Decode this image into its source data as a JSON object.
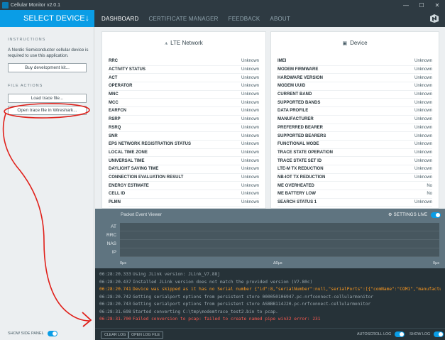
{
  "window": {
    "title": "Cellular Monitor v2.0.1",
    "controls": [
      "—",
      "☐",
      "✕"
    ]
  },
  "header": {
    "select_device": "SELECT DEVICE",
    "tabs": [
      {
        "label": "DASHBOARD",
        "active": true
      },
      {
        "label": "CERTIFICATE MANAGER",
        "active": false
      },
      {
        "label": "FEEDBACK",
        "active": false
      },
      {
        "label": "ABOUT",
        "active": false
      }
    ]
  },
  "sidebar": {
    "instructions_title": "INSTRUCTIONS",
    "instructions_text": "A Nordic Semiconductor cellular device is required to use this application.",
    "buy_button": "Buy development kit...",
    "file_actions_title": "FILE ACTIONS",
    "load_button": "Load trace file...",
    "wireshark_button": "Open trace file in Wireshark...",
    "show_side_panel": "SHOW SIDE PANEL"
  },
  "lte_card": {
    "title": "LTE Network",
    "icon": "antenna-icon",
    "rows": [
      {
        "k": "RRC",
        "v": "Unknown"
      },
      {
        "k": "ACTIVITY STATUS",
        "v": "Unknown"
      },
      {
        "k": "ACT",
        "v": "Unknown"
      },
      {
        "k": "OPERATOR",
        "v": "Unknown"
      },
      {
        "k": "MNC",
        "v": "Unknown"
      },
      {
        "k": "MCC",
        "v": "Unknown"
      },
      {
        "k": "EARFCN",
        "v": "Unknown"
      },
      {
        "k": "RSRP",
        "v": "Unknown"
      },
      {
        "k": "RSRQ",
        "v": "Unknown"
      },
      {
        "k": "SNR",
        "v": "Unknown"
      },
      {
        "k": "EPS NETWORK REGISTRATION STATUS",
        "v": "Unknown"
      },
      {
        "k": "LOCAL TIME ZONE",
        "v": "Unknown"
      },
      {
        "k": "UNIVERSAL TIME",
        "v": "Unknown"
      },
      {
        "k": "DAYLIGHT SAVING TIME",
        "v": "Unknown"
      },
      {
        "k": "CONNECTION EVALUATION RESULT",
        "v": "Unknown"
      },
      {
        "k": "ENERGY ESTIMATE",
        "v": "Unknown"
      },
      {
        "k": "CELL ID",
        "v": "Unknown"
      },
      {
        "k": "PLMN",
        "v": "Unknown"
      }
    ]
  },
  "device_card": {
    "title": "Device",
    "icon": "chip-icon",
    "rows": [
      {
        "k": "IMEI",
        "v": "Unknown"
      },
      {
        "k": "MODEM FIRMWARE",
        "v": "Unknown"
      },
      {
        "k": "HARDWARE VERSION",
        "v": "Unknown"
      },
      {
        "k": "MODEM UUID",
        "v": "Unknown"
      },
      {
        "k": "CURRENT BAND",
        "v": "Unknown"
      },
      {
        "k": "SUPPORTED BANDS",
        "v": "Unknown"
      },
      {
        "k": "DATA PROFILE",
        "v": "Unknown"
      },
      {
        "k": "MANUFACTURER",
        "v": "Unknown"
      },
      {
        "k": "PREFERRED BEARER",
        "v": "Unknown"
      },
      {
        "k": "SUPPORTED BEARERS",
        "v": "Unknown"
      },
      {
        "k": "FUNCTIONAL MODE",
        "v": "Unknown"
      },
      {
        "k": "TRACE STATE OPERATION",
        "v": "Unknown"
      },
      {
        "k": "TRACE STATE SET ID",
        "v": "Unknown"
      },
      {
        "k": "LTE-M TX REDUCTION",
        "v": "Unknown"
      },
      {
        "k": "NB-IOT TX REDUCTION",
        "v": "Unknown"
      },
      {
        "k": "ME OVERHEATED",
        "v": "No"
      },
      {
        "k": "ME BATTERY LOW",
        "v": "No"
      },
      {
        "k": "SEARCH STATUS 1",
        "v": "Unknown"
      }
    ]
  },
  "packet_viewer": {
    "title": "Packet Event Viewer",
    "settings": "SETTINGS",
    "live": "LIVE",
    "lanes": [
      "AT",
      "RRC",
      "NAS",
      "IP"
    ],
    "axis": {
      "start": "0μs",
      "mid": "Δ0μs",
      "end": "0μs"
    }
  },
  "log": [
    {
      "ts": "06:28:20.333",
      "msg": "Using JLink version: JLink_V7.88j",
      "level": "info"
    },
    {
      "ts": "06:28:20.437",
      "msg": "Installed JLink version does not match the provided version (V7.80c)",
      "level": "info"
    },
    {
      "ts": "06:28:20.741",
      "msg": "Device was skipped as it has no Serial number {\"id\":8,\"serialNumber\":null,\"serialPorts\":[{\"comName\":\"COM1\",\"manufacturer\":\"(Standard",
      "level": "warn"
    },
    {
      "ts": "06:28:20.742",
      "msg": "Getting serialport options from persistent store 000050106947.pc-nrfconnect-cellularmonitor",
      "level": "info"
    },
    {
      "ts": "06:28:20.743",
      "msg": "Getting serialport options from persistent store ASBBB114J20.pc-nrfconnect-cellularmonitor",
      "level": "info"
    },
    {
      "ts": "06:28:31.698",
      "msg": "Started converting C:\\tmp\\modemtrace_test2.bin to pcap.",
      "level": "info"
    },
    {
      "ts": "06:28:31.700",
      "msg": "Failed conversion to pcap: failed to create named pipe win32 error: 231",
      "level": "err"
    }
  ],
  "bottom": {
    "clear_log": "CLEAR LOG",
    "open_log_file": "OPEN LOG FILE",
    "autoscroll": "AUTOSCROLL LOG",
    "show_log": "SHOW LOG"
  },
  "colors": {
    "accent": "#0a9de6",
    "header_bg": "#2e3a42",
    "log_warn": "#ff9a1f",
    "log_error": "#ff5a4f",
    "annotation": "#e0201a"
  }
}
